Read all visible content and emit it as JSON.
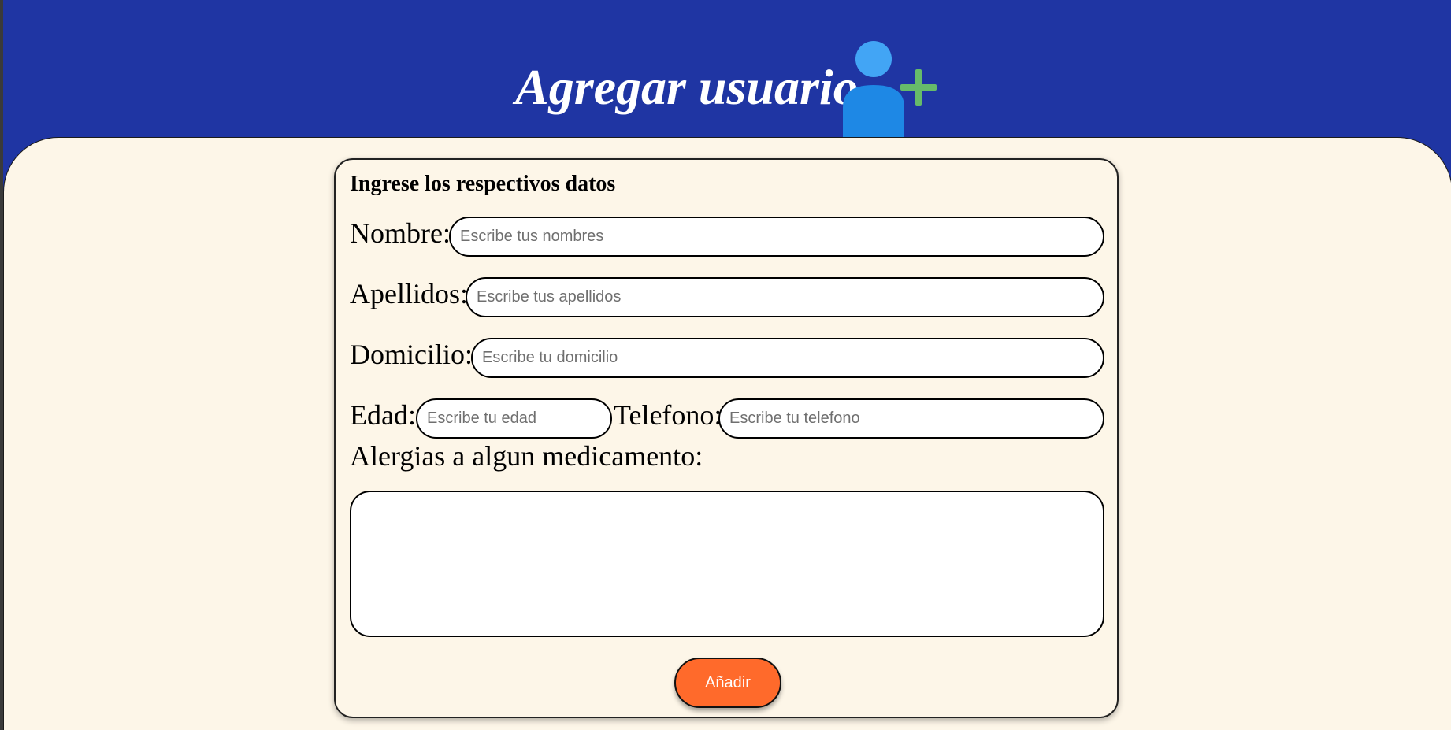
{
  "header": {
    "title": "Agregar usuario",
    "icon": "add-user-icon",
    "icon_colors": {
      "head": "#42a5f5",
      "body": "#1e88e5",
      "plus": "#66bb6a"
    }
  },
  "colors": {
    "header_background": "#1f35a3",
    "panel_background": "#fdf6e8",
    "button_background": "#ff6a2b"
  },
  "form": {
    "heading": "Ingrese los respectivos datos",
    "fields": {
      "nombre": {
        "label": "Nombre:",
        "placeholder": "Escribe tus nombres",
        "value": ""
      },
      "apellidos": {
        "label": "Apellidos:",
        "placeholder": "Escribe tus apellidos",
        "value": ""
      },
      "domicilio": {
        "label": "Domicilio:",
        "placeholder": "Escribe tu domicilio",
        "value": ""
      },
      "edad": {
        "label": "Edad:",
        "placeholder": "Escribe tu edad",
        "value": ""
      },
      "telefono": {
        "label": "Telefono:",
        "placeholder": "Escribe tu telefono",
        "value": ""
      },
      "alergias": {
        "label": "Alergias a algun medicamento:",
        "value": ""
      }
    },
    "submit_label": "Añadir"
  }
}
